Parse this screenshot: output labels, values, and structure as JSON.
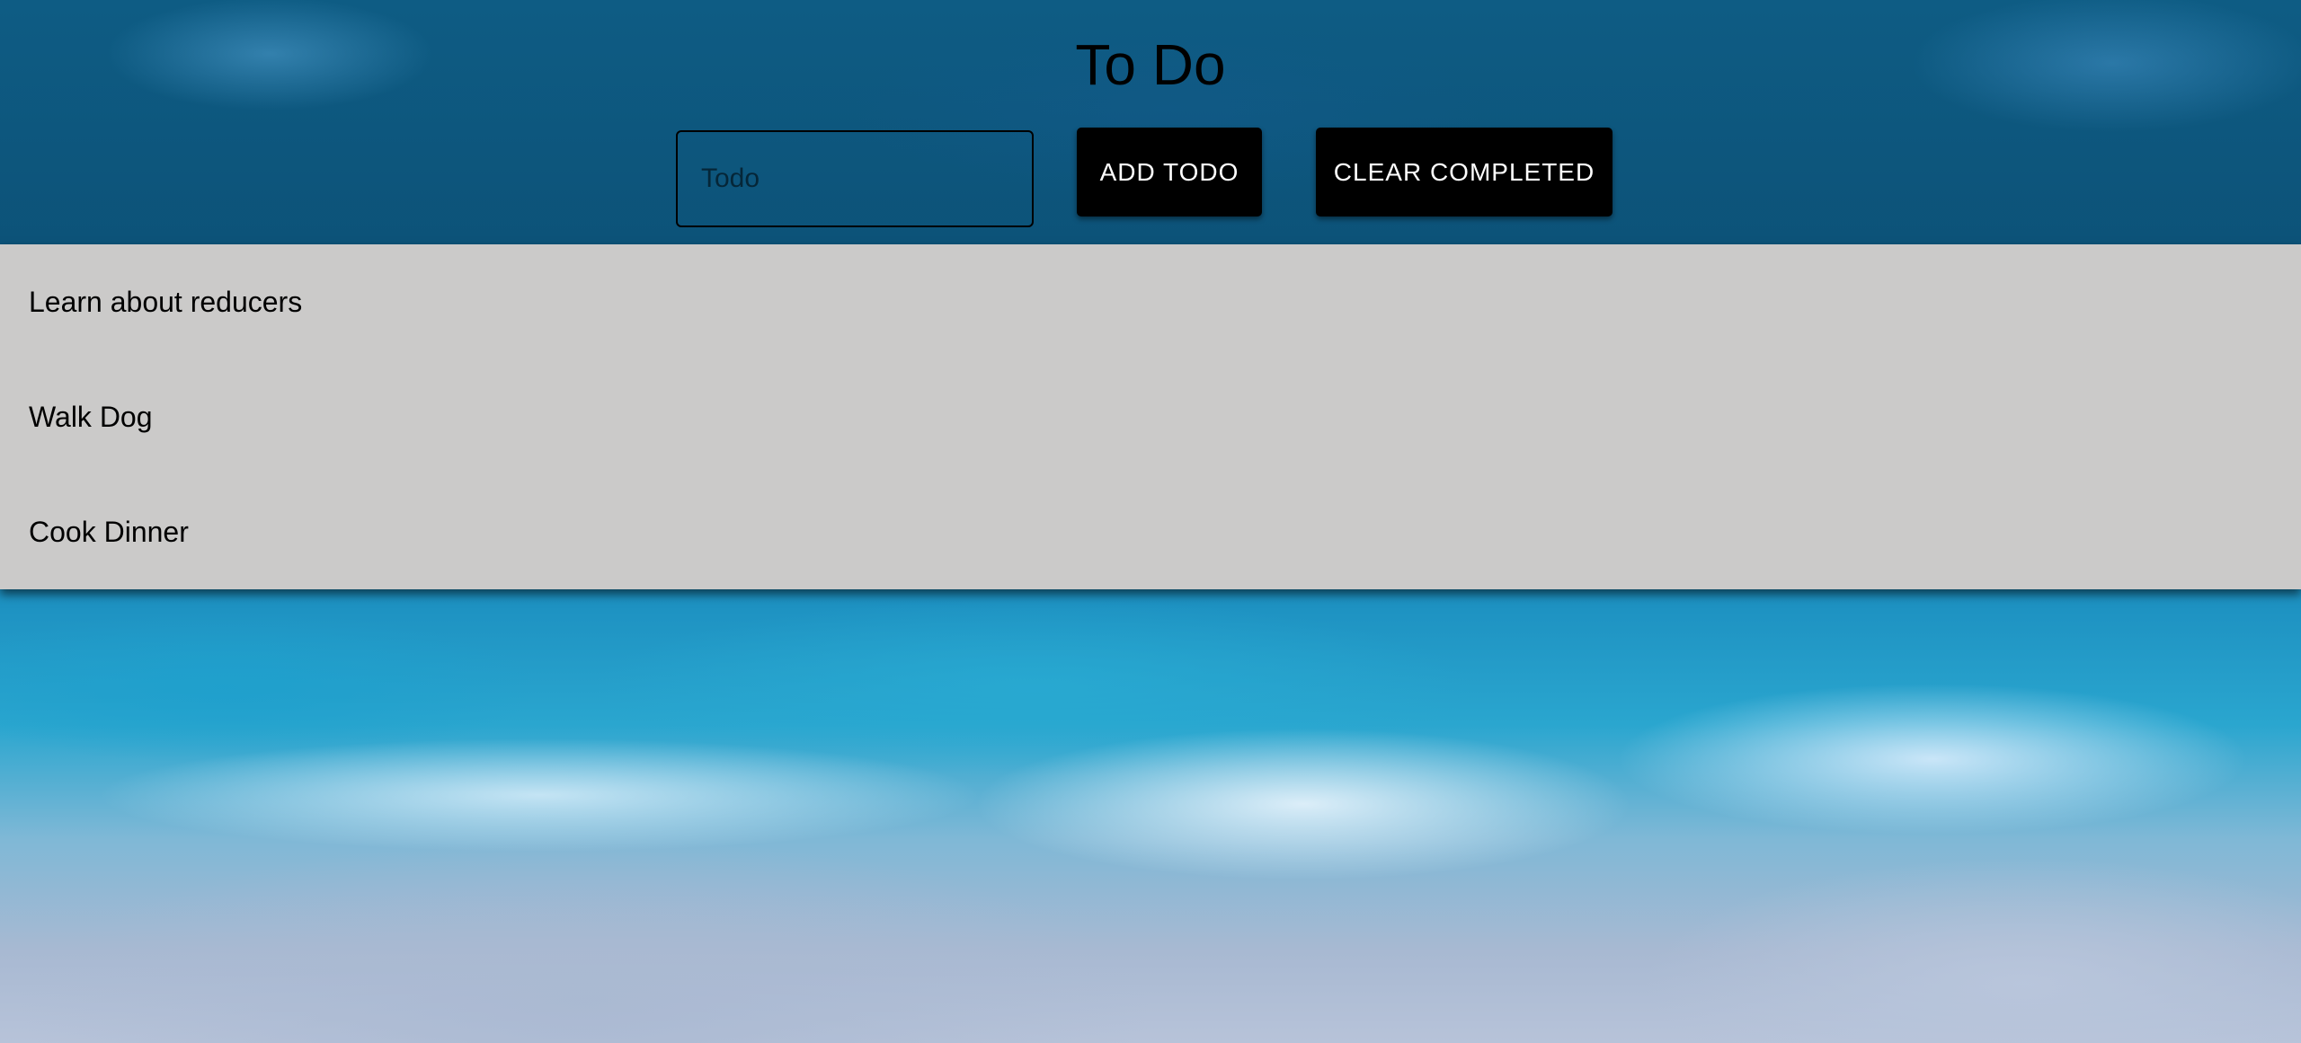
{
  "header": {
    "title": "To Do",
    "input_placeholder": "Todo",
    "input_value": "",
    "add_button_label": "ADD TODO",
    "clear_button_label": "CLEAR COMPLETED"
  },
  "todos": [
    {
      "text": "Learn about reducers"
    },
    {
      "text": "Walk Dog"
    },
    {
      "text": "Cook Dinner"
    }
  ],
  "colors": {
    "list_background": "#cbcac9",
    "button_background": "#000000",
    "button_text": "#ffffff"
  }
}
